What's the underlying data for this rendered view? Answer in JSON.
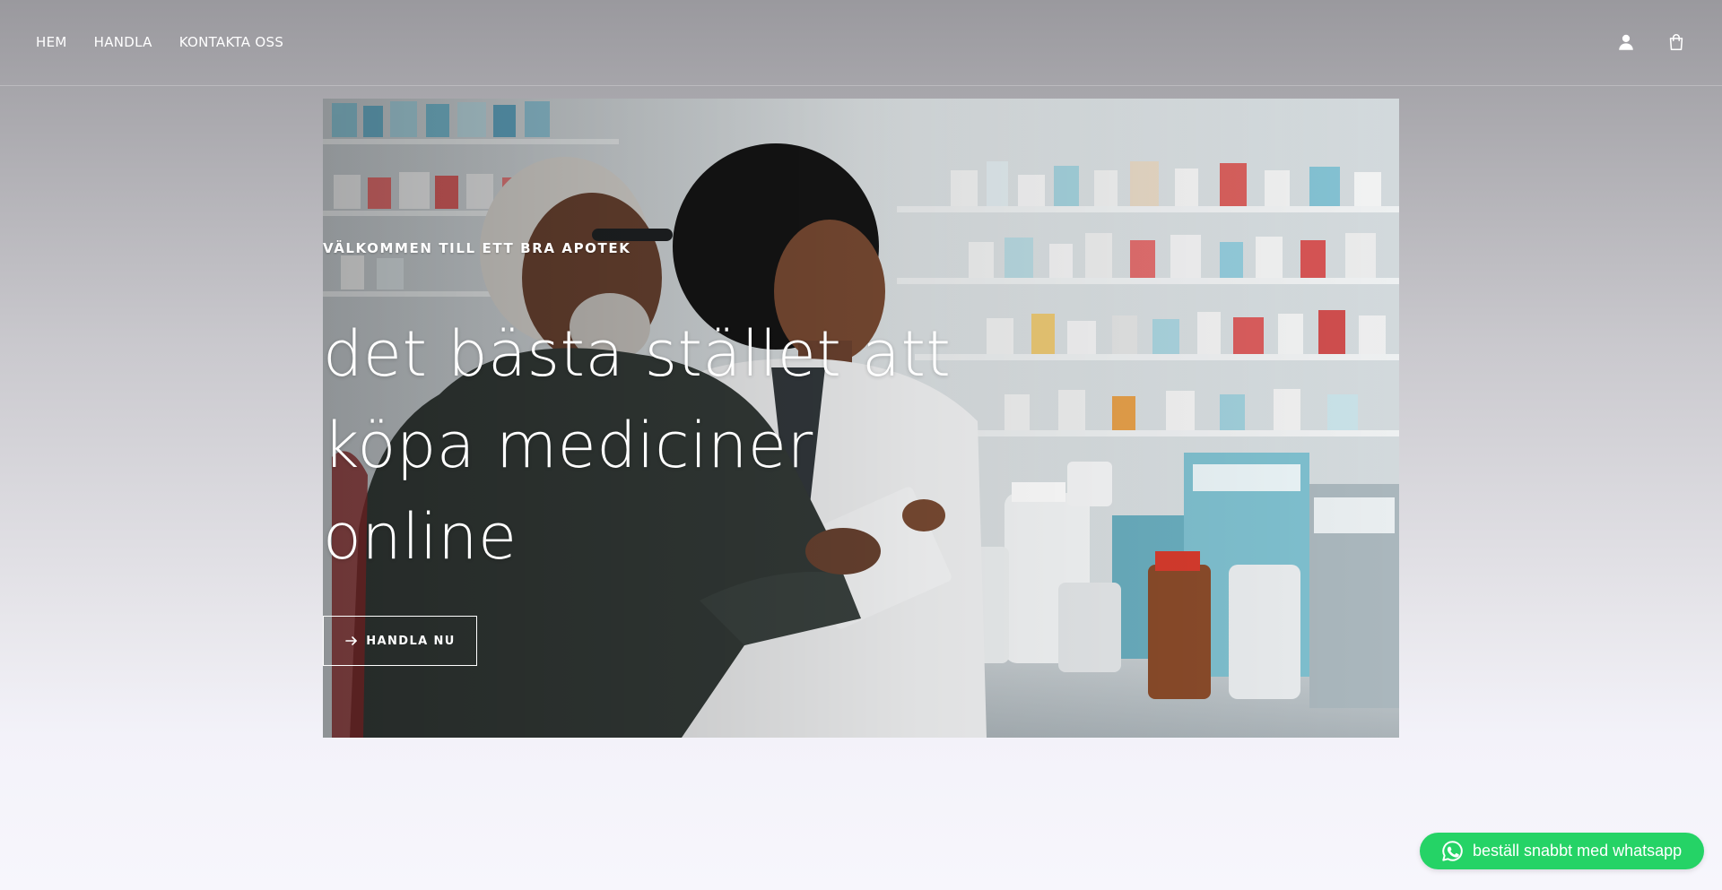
{
  "nav": {
    "items": [
      {
        "label": "HEM"
      },
      {
        "label": "HANDLA"
      },
      {
        "label": "KONTAKTA OSS"
      }
    ]
  },
  "header": {
    "account_icon": "user-icon",
    "cart_icon": "shopping-bag-icon"
  },
  "hero": {
    "eyebrow": "VÄLKOMMEN TILL ETT BRA APOTEK",
    "headline": "det bästa stället att köpa mediciner online",
    "cta_label": "HANDLA NU",
    "cta_icon": "arrow-right-icon"
  },
  "whatsapp": {
    "label": "beställ snabbt med whatsapp",
    "icon": "whatsapp-icon",
    "color": "#25d366"
  }
}
